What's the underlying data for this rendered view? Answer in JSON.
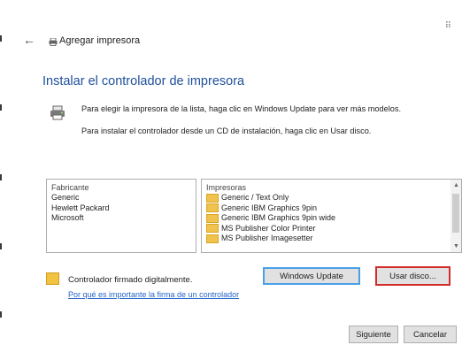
{
  "window": {
    "title": "Agregar impresora",
    "corner_glyph": "⠿"
  },
  "main": {
    "heading": "Instalar el controlador de impresora",
    "instruction_1": "Para elegir la impresora de la lista, haga clic en Windows Update para ver más modelos.",
    "instruction_2": "Para instalar el controlador desde un CD de instalación, haga clic en Usar disco."
  },
  "manufacturers": {
    "header": "Fabricante",
    "items": [
      "Generic",
      "Hewlett Packard",
      "Microsoft"
    ]
  },
  "printers": {
    "header": "Impresoras",
    "items": [
      "Generic / Text Only",
      "Generic IBM Graphics 9pin",
      "Generic IBM Graphics 9pin wide",
      "MS Publisher Color Printer",
      "MS Publisher Imagesetter"
    ]
  },
  "signature": {
    "text": "Controlador firmado digitalmente.",
    "link": "Por qué es importante la firma de un controlador"
  },
  "buttons": {
    "windows_update": "Windows Update",
    "use_disk": "Usar disco...",
    "next": "Siguiente",
    "cancel": "Cancelar"
  },
  "colors": {
    "heading": "#1f4f9a",
    "link": "#2464c8",
    "focus_border": "#4aa0e8",
    "highlight_border": "#d52a2a"
  }
}
